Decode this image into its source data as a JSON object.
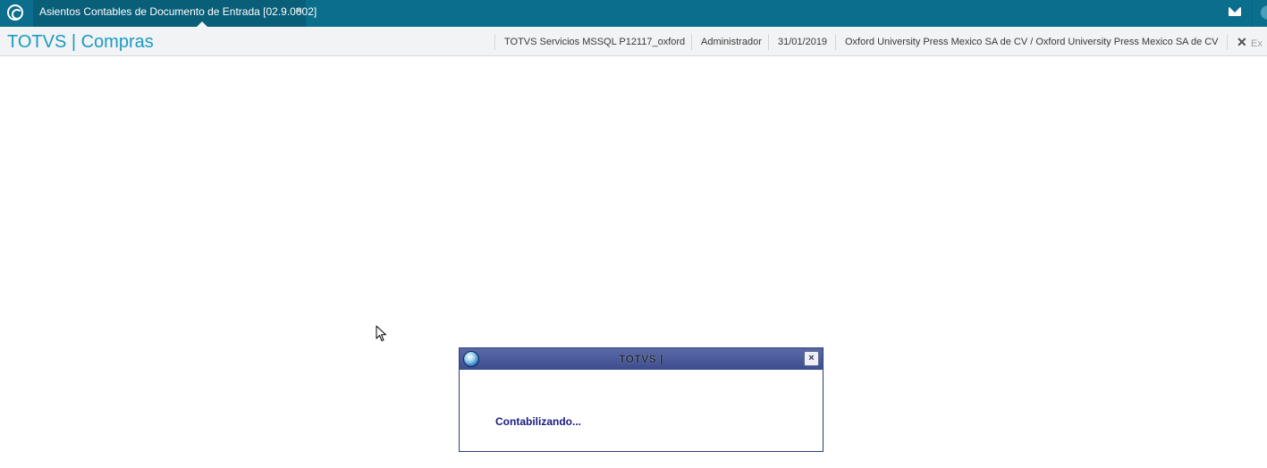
{
  "tab_bar": {
    "active_tab": {
      "title": "Asientos Contables de Documento de Entrada [02.9.0002]",
      "close_glyph": "×"
    },
    "icons": [
      "app-logo-icon",
      "mail-icon",
      "user-avatar-icon"
    ],
    "background_color": "#0b6e8c"
  },
  "header": {
    "brand": "TOTVS | Compras",
    "environment": "TOTVS Servicios MSSQL P12117_oxford",
    "user": "Administrador",
    "date": "31/01/2019",
    "company": "Oxford University Press Mexico SA de CV / Oxford University Press Mexico SA de CV",
    "exit_label": "Ex",
    "exit_glyph": "✕",
    "brand_color": "#1a9bc4"
  },
  "dialog": {
    "title": "TOTVS |",
    "close_glyph": "×",
    "message": "Contabilizando...",
    "message_color": "#1a1a80",
    "title_bar_color": "#3c4c8e"
  }
}
